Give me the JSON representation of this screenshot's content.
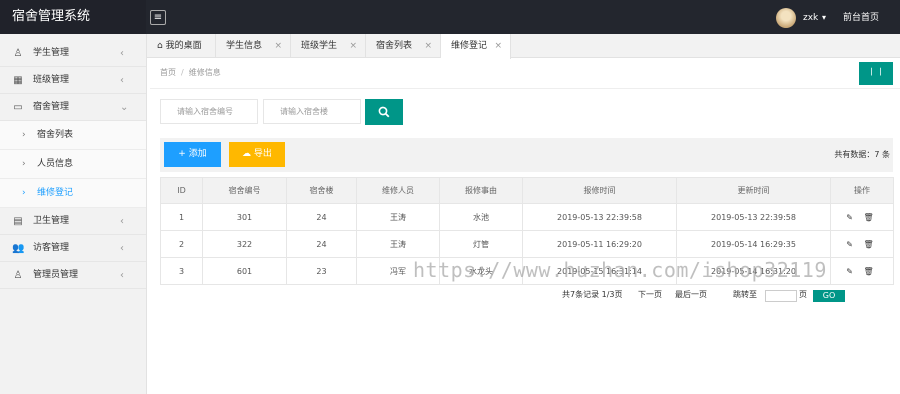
{
  "app": {
    "title": "宿舍管理系统"
  },
  "header": {
    "menu_icon": "≡",
    "user": "zxk",
    "caret": "▾",
    "front_link": "前台首页"
  },
  "sidebar": {
    "items": [
      {
        "label": "学生管理",
        "icon": "user-icon",
        "glyph": "♙",
        "arrow": "‹"
      },
      {
        "label": "班级管理",
        "icon": "calendar-icon",
        "glyph": "▦",
        "arrow": "‹"
      },
      {
        "label": "宿舍管理",
        "icon": "inbox-icon",
        "glyph": "▭",
        "arrow": "⌄"
      },
      {
        "label": "卫生管理",
        "icon": "document-icon",
        "glyph": "▤",
        "arrow": "‹"
      },
      {
        "label": "访客管理",
        "icon": "users-icon",
        "glyph": "👥",
        "arrow": "‹"
      },
      {
        "label": "管理员管理",
        "icon": "admin-icon",
        "glyph": "♙",
        "arrow": "‹"
      }
    ],
    "sub_items": [
      {
        "label": "宿舍列表",
        "chevron": "›"
      },
      {
        "label": "人员信息",
        "chevron": "›"
      },
      {
        "label": "维修登记",
        "chevron": "›"
      }
    ]
  },
  "tabs": [
    {
      "label": "我的桌面",
      "icon": "home-icon",
      "glyph": "⌂",
      "close": ""
    },
    {
      "label": "学生信息",
      "close": "×"
    },
    {
      "label": "班级学生",
      "close": "×"
    },
    {
      "label": "宿舍列表",
      "close": "×"
    },
    {
      "label": "维修登记",
      "close": "×"
    }
  ],
  "breadcrumb": {
    "home": "首页",
    "separator": "/",
    "current": "维修信息"
  },
  "refresh_label": "〡〡",
  "search": {
    "dorm_no_placeholder": "请输入宿舍编号",
    "building_placeholder": "请输入宿舍楼",
    "button_icon": "search-icon"
  },
  "toolbar": {
    "add_label": "添加",
    "add_glyph": "+",
    "export_label": "导出",
    "export_glyph": "☁",
    "total_text": "共有数据：7 条"
  },
  "table": {
    "headers": [
      "ID",
      "宿舍编号",
      "宿舍楼",
      "维修人员",
      "报修事由",
      "报修时间",
      "更新时间",
      "操作"
    ],
    "rows": [
      [
        "1",
        "301",
        "24",
        "王涛",
        "水池",
        "2019-05-13 22:39:58",
        "2019-05-13 22:39:58"
      ],
      [
        "2",
        "322",
        "24",
        "王涛",
        "灯管",
        "2019-05-11 16:29:20",
        "2019-05-14 16:29:35"
      ],
      [
        "3",
        "601",
        "23",
        "冯军",
        "水龙头",
        "2019-05-15 16:31:14",
        "2019-05-14 16:31:20"
      ]
    ],
    "op_glyphs": "✎ 🗑"
  },
  "pager": {
    "summary": "共7条记录  1/3页",
    "next": "下一页",
    "last": "最后一页",
    "jump_label": "跳转至",
    "page_unit": "页",
    "go": "GO"
  },
  "watermark": "https://www.huzhan.com/ishop32119"
}
